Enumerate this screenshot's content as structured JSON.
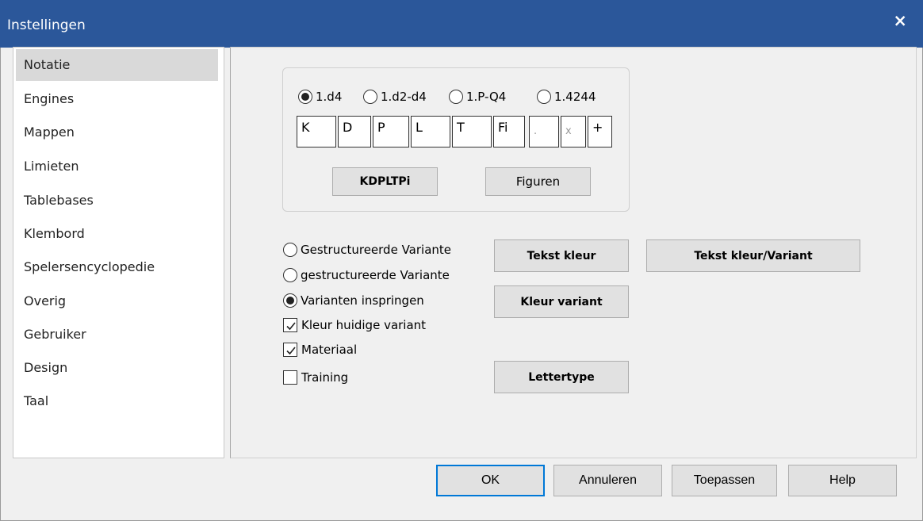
{
  "window": {
    "title": "Instellingen",
    "close_glyph": "×"
  },
  "sidebar": {
    "items": [
      {
        "label": "Notatie",
        "selected": true
      },
      {
        "label": "Engines"
      },
      {
        "label": "Mappen"
      },
      {
        "label": "Limieten"
      },
      {
        "label": "Tablebases"
      },
      {
        "label": "Klembord"
      },
      {
        "label": "Spelersencyclopedie"
      },
      {
        "label": "Overig"
      },
      {
        "label": "Gebruiker"
      },
      {
        "label": "Design"
      },
      {
        "label": "Taal"
      }
    ]
  },
  "notation": {
    "formats": [
      {
        "label": "1.d4",
        "checked": true
      },
      {
        "label": "1.d2-d4",
        "checked": false
      },
      {
        "label": "1.P-Q4",
        "checked": false
      },
      {
        "label": "1.4244",
        "checked": false
      }
    ],
    "pieces": [
      "K",
      "D",
      "P",
      "L",
      "T",
      "Fi",
      ".",
      "x",
      "+"
    ],
    "kdpltpi_button": "KDPLTPi",
    "figuren_button": "Figuren"
  },
  "variants": {
    "options": [
      {
        "label": "Gestructureerde Variante",
        "checked": false
      },
      {
        "label": "gestructureerde Variante",
        "checked": false
      },
      {
        "label": "Varianten inspringen",
        "checked": true
      }
    ],
    "checkboxes": [
      {
        "label": "Kleur huidige variant",
        "checked": true
      },
      {
        "label": "Materiaal",
        "checked": true
      },
      {
        "label": "Training",
        "checked": false
      }
    ],
    "buttons": {
      "tekst_kleur": "Tekst kleur",
      "tekst_kleur_variant": "Tekst kleur/Variant",
      "kleur_variant": "Kleur variant",
      "lettertype": "Lettertype"
    }
  },
  "footer": {
    "ok": "OK",
    "cancel": "Annuleren",
    "apply": "Toepassen",
    "help": "Help"
  }
}
